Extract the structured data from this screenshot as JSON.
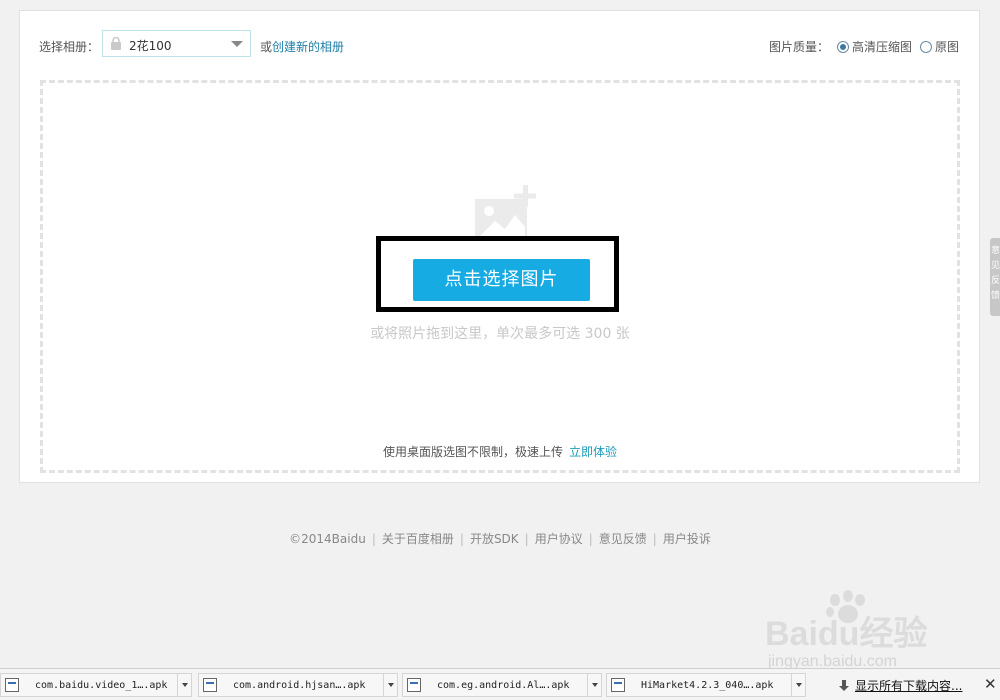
{
  "toolbar": {
    "album_label": "选择相册：",
    "album_value": "2花100",
    "create_prefix": "或",
    "create_link": "创建新的相册",
    "quality_label": "图片质量：",
    "quality_options": [
      {
        "label": "高清压缩图",
        "checked": true
      },
      {
        "label": "原图",
        "checked": false
      }
    ]
  },
  "upload": {
    "choose_button": "点击选择图片",
    "drag_hint": "或将照片拖到这里，单次最多可选 300 张",
    "desktop_hint": "使用桌面版选图不限制，极速上传",
    "desktop_link": "立即体验"
  },
  "side_tab": "意见反馈",
  "footer": {
    "copyright": "©2014Baidu",
    "links": [
      "关于百度相册",
      "开放SDK",
      "用户协议",
      "意见反馈",
      "用户投诉"
    ]
  },
  "watermark": {
    "brand": "Baidu经验",
    "url": "jingyan.baidu.com"
  },
  "downloads": {
    "items": [
      "com.baidu.video_1….apk",
      "com.android.hjsan….apk",
      "com.eg.android.Al….apk",
      "HiMarket4.2.3_040….apk"
    ],
    "show_all": "显示所有下载内容..."
  }
}
